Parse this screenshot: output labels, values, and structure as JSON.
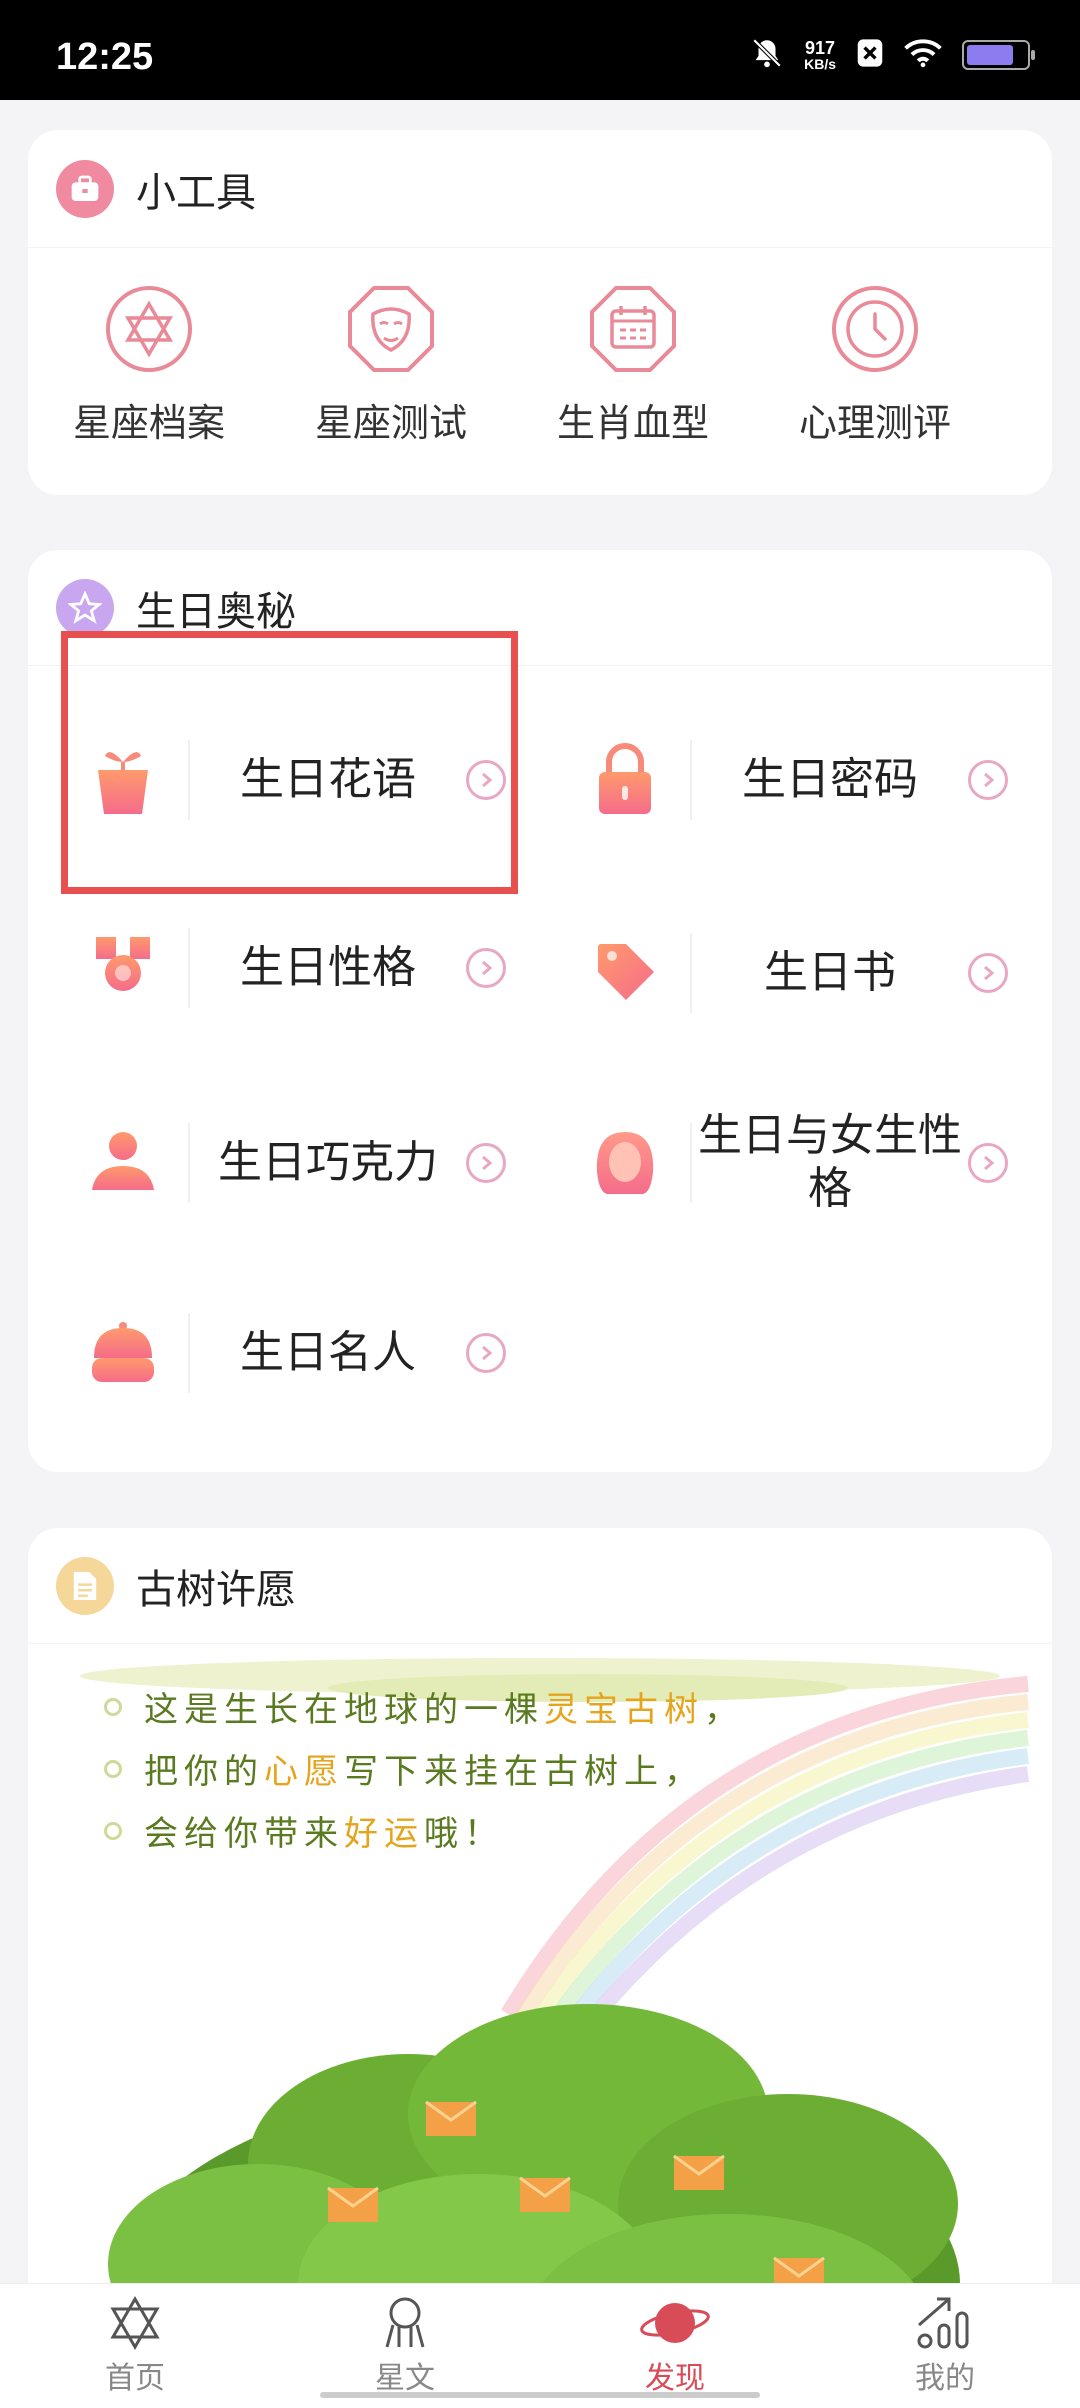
{
  "status": {
    "time": "12:25",
    "speed_value": "917",
    "speed_unit": "KB/s",
    "battery_level": 0.8
  },
  "tools": {
    "title": "小工具",
    "items": [
      {
        "label": "星座档案",
        "icon": "hexagram-icon"
      },
      {
        "label": "星座测试",
        "icon": "face-mask-icon"
      },
      {
        "label": "生肖血型",
        "icon": "calendar-icon"
      },
      {
        "label": "心理测评",
        "icon": "clock-icon"
      }
    ]
  },
  "birthday": {
    "title": "生日奥秘",
    "items": [
      {
        "label": "生日花语",
        "icon": "flower-pot-icon"
      },
      {
        "label": "生日密码",
        "icon": "lock-icon"
      },
      {
        "label": "生日性格",
        "icon": "medal-icon"
      },
      {
        "label": "生日书",
        "icon": "tag-icon"
      },
      {
        "label": "生日巧克力",
        "icon": "person-icon"
      },
      {
        "label": "生日与女生性格",
        "icon": "woman-icon"
      },
      {
        "label": "生日名人",
        "icon": "cake-icon"
      }
    ]
  },
  "wish": {
    "title": "古树许愿",
    "line1": {
      "a": "这是生长在地球的一棵",
      "b": "灵宝古树",
      "c": "，"
    },
    "line2": {
      "a": "把你的",
      "b": "心愿",
      "c": "写下来挂在古树上，"
    },
    "line3": {
      "a": "会给你带来",
      "b": "好运",
      "c": "哦！"
    }
  },
  "nav": {
    "items": [
      {
        "label": "首页"
      },
      {
        "label": "星文"
      },
      {
        "label": "发现"
      },
      {
        "label": "我的"
      }
    ],
    "active": "发现"
  },
  "colors": {
    "accent": "#d84c58",
    "highlight_box": "#e84f4f",
    "icon_pink": "#e98a98",
    "icon_gradient_start": "#ff8f6b",
    "icon_gradient_end": "#f56c8a"
  }
}
